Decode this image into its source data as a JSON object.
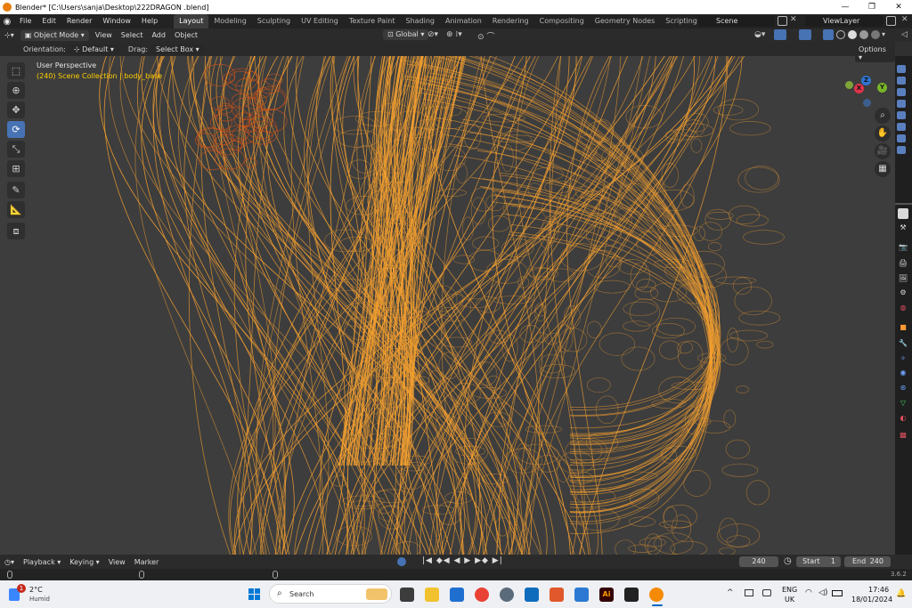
{
  "window": {
    "title": "Blender* [C:\\Users\\sanja\\Desktop\\222DRAGON .blend]",
    "controls": [
      "—",
      "❐",
      "✕"
    ]
  },
  "menus": [
    "File",
    "Edit",
    "Render",
    "Window",
    "Help"
  ],
  "workspaces": [
    "Layout",
    "Modeling",
    "Sculpting",
    "UV Editing",
    "Texture Paint",
    "Shading",
    "Animation",
    "Rendering",
    "Compositing",
    "Geometry Nodes",
    "Scripting"
  ],
  "active_workspace": "Layout",
  "add_workspace": "+",
  "scene": {
    "name": "Scene",
    "view_layer": "ViewLayer"
  },
  "header": {
    "mode": "Object Mode",
    "view": "View",
    "select": "Select",
    "add": "Add",
    "object": "Object",
    "transform": "Global"
  },
  "tool_settings": {
    "orientation_label": "Orientation:",
    "orientation_value": "Default",
    "drag_label": "Drag:",
    "drag_value": "Select Box",
    "options": "Options"
  },
  "viewport": {
    "perspective": "User Perspective",
    "collection": "(240) Scene Collection | body_base",
    "gizmo": {
      "x": "X",
      "y": "Y",
      "z": "Z"
    },
    "wire_color": "#f5a030",
    "bg_color": "#3d3d3d"
  },
  "timeline": {
    "playback": "Playback",
    "keying": "Keying",
    "view": "View",
    "marker": "Marker",
    "current_frame": "240",
    "start_label": "Start",
    "start": "1",
    "end_label": "End",
    "end": "240"
  },
  "statusbar": {
    "version": "3.6.2"
  },
  "taskbar": {
    "weather_temp": "2°C",
    "weather_desc": "Humid",
    "notification_count": "1",
    "search_placeholder": "Search",
    "lang_top": "ENG",
    "lang_bottom": "UK",
    "time": "17:46",
    "date": "18/01/2024"
  }
}
